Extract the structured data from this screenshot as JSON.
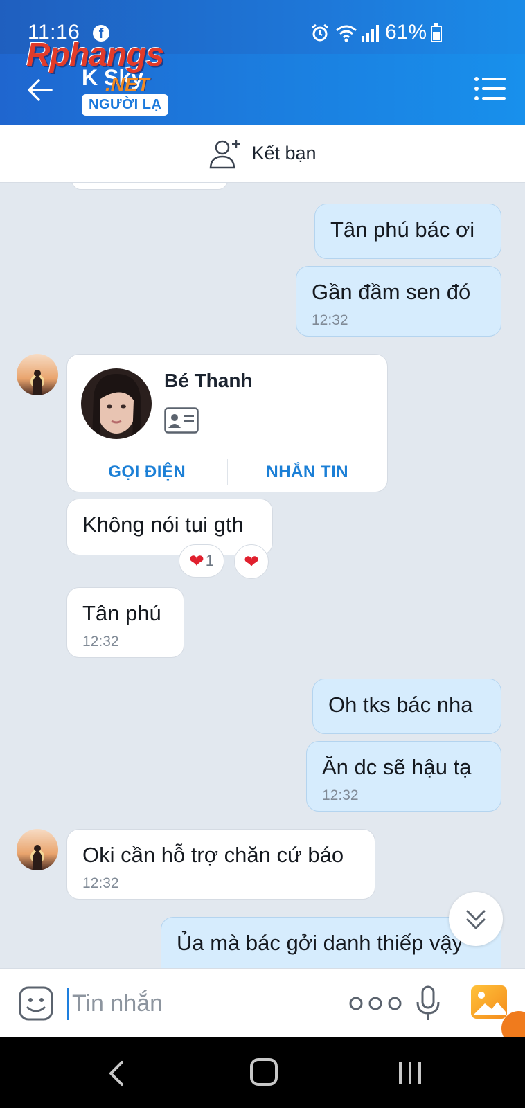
{
  "status_bar": {
    "time": "11:16",
    "battery_percent": "61%",
    "battery_level": 0.61,
    "icons": [
      "facebook-icon",
      "alarm-icon",
      "wifi-icon",
      "signal-icon",
      "battery-icon"
    ]
  },
  "header": {
    "contact_name": "K Sky",
    "badge": "NGƯỜI LẠ",
    "watermark": "Rphangs",
    "watermark_suffix": ".NET",
    "colors": {
      "header": "#1b7fe0",
      "accent": "#1b7fd6"
    }
  },
  "friend_bar": {
    "label": "Kết bạn"
  },
  "messages": [
    {
      "direction": "out",
      "text": "Tân phú bác ơi",
      "time": ""
    },
    {
      "direction": "out",
      "text": "Gần đầm sen đó",
      "time": "12:32"
    },
    {
      "direction": "in",
      "type": "contact_card",
      "name": "Bé Thanh",
      "actions": [
        "GỌI ĐIỆN",
        "NHẮN TIN"
      ]
    },
    {
      "direction": "in",
      "text": "Không nói tui gth",
      "reaction_count": "1"
    },
    {
      "direction": "in",
      "text": "Tân phú",
      "time": "12:32"
    },
    {
      "direction": "out",
      "text": "Oh tks bác nha",
      "time": ""
    },
    {
      "direction": "out",
      "text": "Ăn dc sẽ hậu tạ",
      "time": "12:32"
    },
    {
      "direction": "in",
      "text": "Oki cần hỗ trợ chăn cứ báo",
      "time": "12:32"
    },
    {
      "direction": "out",
      "text": "Ủa mà bác gởi danh thiếp vậy"
    }
  ],
  "input": {
    "placeholder": "Tin nhắn"
  }
}
